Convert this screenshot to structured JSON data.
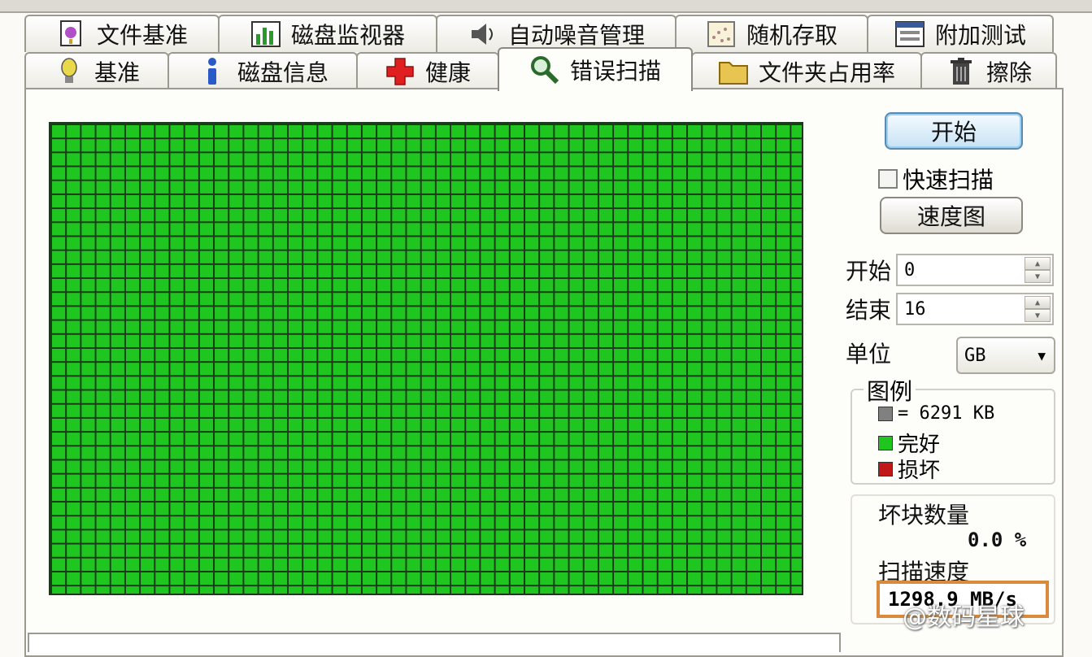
{
  "tabs_back": [
    {
      "label": "文件基准",
      "icon": "file-benchmark-icon"
    },
    {
      "label": "磁盘监视器",
      "icon": "disk-monitor-icon"
    },
    {
      "label": "自动噪音管理",
      "icon": "speaker-icon"
    },
    {
      "label": "随机存取",
      "icon": "random-access-icon"
    },
    {
      "label": "附加测试",
      "icon": "extra-tests-icon"
    }
  ],
  "tabs_front": [
    {
      "label": "基准",
      "icon": "lightbulb-icon"
    },
    {
      "label": "磁盘信息",
      "icon": "info-icon"
    },
    {
      "label": "健康",
      "icon": "health-cross-icon"
    },
    {
      "label": "错误扫描",
      "icon": "magnifier-icon",
      "active": true
    },
    {
      "label": "文件夹占用率",
      "icon": "folder-icon"
    },
    {
      "label": "擦除",
      "icon": "trash-icon"
    }
  ],
  "controls": {
    "start_button": "开始",
    "quick_scan_label": "快速扫描",
    "quick_scan_checked": false,
    "speed_map_button": "速度图",
    "start_label": "开始",
    "start_value": "0",
    "end_label": "结束",
    "end_value": "16",
    "unit_label": "单位",
    "unit_value": "GB"
  },
  "legend": {
    "title": "图例",
    "block_size": "= 6291 KB",
    "good": "完好",
    "bad": "损坏"
  },
  "stats": {
    "bad_blocks_label": "坏块数量",
    "bad_blocks_value": "0.0 %",
    "scan_speed_label": "扫描速度",
    "scan_speed_value": "1298.9 MB/s"
  },
  "watermark": "@数码星球",
  "colors": {
    "good": "#1fc61f",
    "bad": "#c01818",
    "block": "#808080"
  }
}
